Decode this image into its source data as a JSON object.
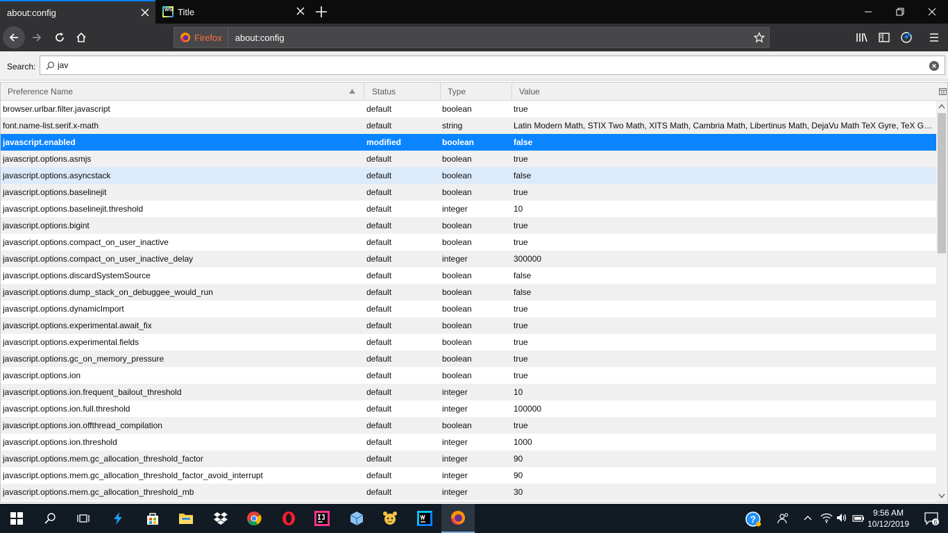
{
  "tabs": [
    {
      "title": "about:config",
      "active": true
    },
    {
      "title": "Title",
      "active": false
    }
  ],
  "navbar": {
    "identity_label": "Firefox",
    "url": "about:config"
  },
  "search": {
    "label": "Search:",
    "value": "jav"
  },
  "columns": {
    "name": "Preference Name",
    "status": "Status",
    "type": "Type",
    "value": "Value"
  },
  "rows": [
    {
      "name": "browser.urlbar.filter.javascript",
      "status": "default",
      "type": "boolean",
      "value": "true"
    },
    {
      "name": "font.name-list.serif.x-math",
      "status": "default",
      "type": "string",
      "value": "Latin Modern Math, STIX Two Math, XITS Math, Cambria Math, Libertinus Math, DejaVu Math TeX Gyre, TeX Gyre ..."
    },
    {
      "name": "javascript.enabled",
      "status": "modified",
      "type": "boolean",
      "value": "false",
      "selected": true
    },
    {
      "name": "javascript.options.asmjs",
      "status": "default",
      "type": "boolean",
      "value": "true"
    },
    {
      "name": "javascript.options.asyncstack",
      "status": "default",
      "type": "boolean",
      "value": "false",
      "hover": true
    },
    {
      "name": "javascript.options.baselinejit",
      "status": "default",
      "type": "boolean",
      "value": "true"
    },
    {
      "name": "javascript.options.baselinejit.threshold",
      "status": "default",
      "type": "integer",
      "value": "10"
    },
    {
      "name": "javascript.options.bigint",
      "status": "default",
      "type": "boolean",
      "value": "true"
    },
    {
      "name": "javascript.options.compact_on_user_inactive",
      "status": "default",
      "type": "boolean",
      "value": "true"
    },
    {
      "name": "javascript.options.compact_on_user_inactive_delay",
      "status": "default",
      "type": "integer",
      "value": "300000"
    },
    {
      "name": "javascript.options.discardSystemSource",
      "status": "default",
      "type": "boolean",
      "value": "false"
    },
    {
      "name": "javascript.options.dump_stack_on_debuggee_would_run",
      "status": "default",
      "type": "boolean",
      "value": "false"
    },
    {
      "name": "javascript.options.dynamicImport",
      "status": "default",
      "type": "boolean",
      "value": "true"
    },
    {
      "name": "javascript.options.experimental.await_fix",
      "status": "default",
      "type": "boolean",
      "value": "true"
    },
    {
      "name": "javascript.options.experimental.fields",
      "status": "default",
      "type": "boolean",
      "value": "true"
    },
    {
      "name": "javascript.options.gc_on_memory_pressure",
      "status": "default",
      "type": "boolean",
      "value": "true"
    },
    {
      "name": "javascript.options.ion",
      "status": "default",
      "type": "boolean",
      "value": "true"
    },
    {
      "name": "javascript.options.ion.frequent_bailout_threshold",
      "status": "default",
      "type": "integer",
      "value": "10"
    },
    {
      "name": "javascript.options.ion.full.threshold",
      "status": "default",
      "type": "integer",
      "value": "100000"
    },
    {
      "name": "javascript.options.ion.offthread_compilation",
      "status": "default",
      "type": "boolean",
      "value": "true"
    },
    {
      "name": "javascript.options.ion.threshold",
      "status": "default",
      "type": "integer",
      "value": "1000"
    },
    {
      "name": "javascript.options.mem.gc_allocation_threshold_factor",
      "status": "default",
      "type": "integer",
      "value": "90"
    },
    {
      "name": "javascript.options.mem.gc_allocation_threshold_factor_avoid_interrupt",
      "status": "default",
      "type": "integer",
      "value": "90"
    },
    {
      "name": "javascript.options.mem.gc_allocation_threshold_mb",
      "status": "default",
      "type": "integer",
      "value": "30"
    }
  ],
  "taskbar": {
    "time": "9:56 AM",
    "date": "10/12/2019",
    "notification_count": "6"
  },
  "colors": {
    "accent": "#0a84ff",
    "selected_row": "#0a84ff",
    "firefox_orange": "#ff7139"
  }
}
